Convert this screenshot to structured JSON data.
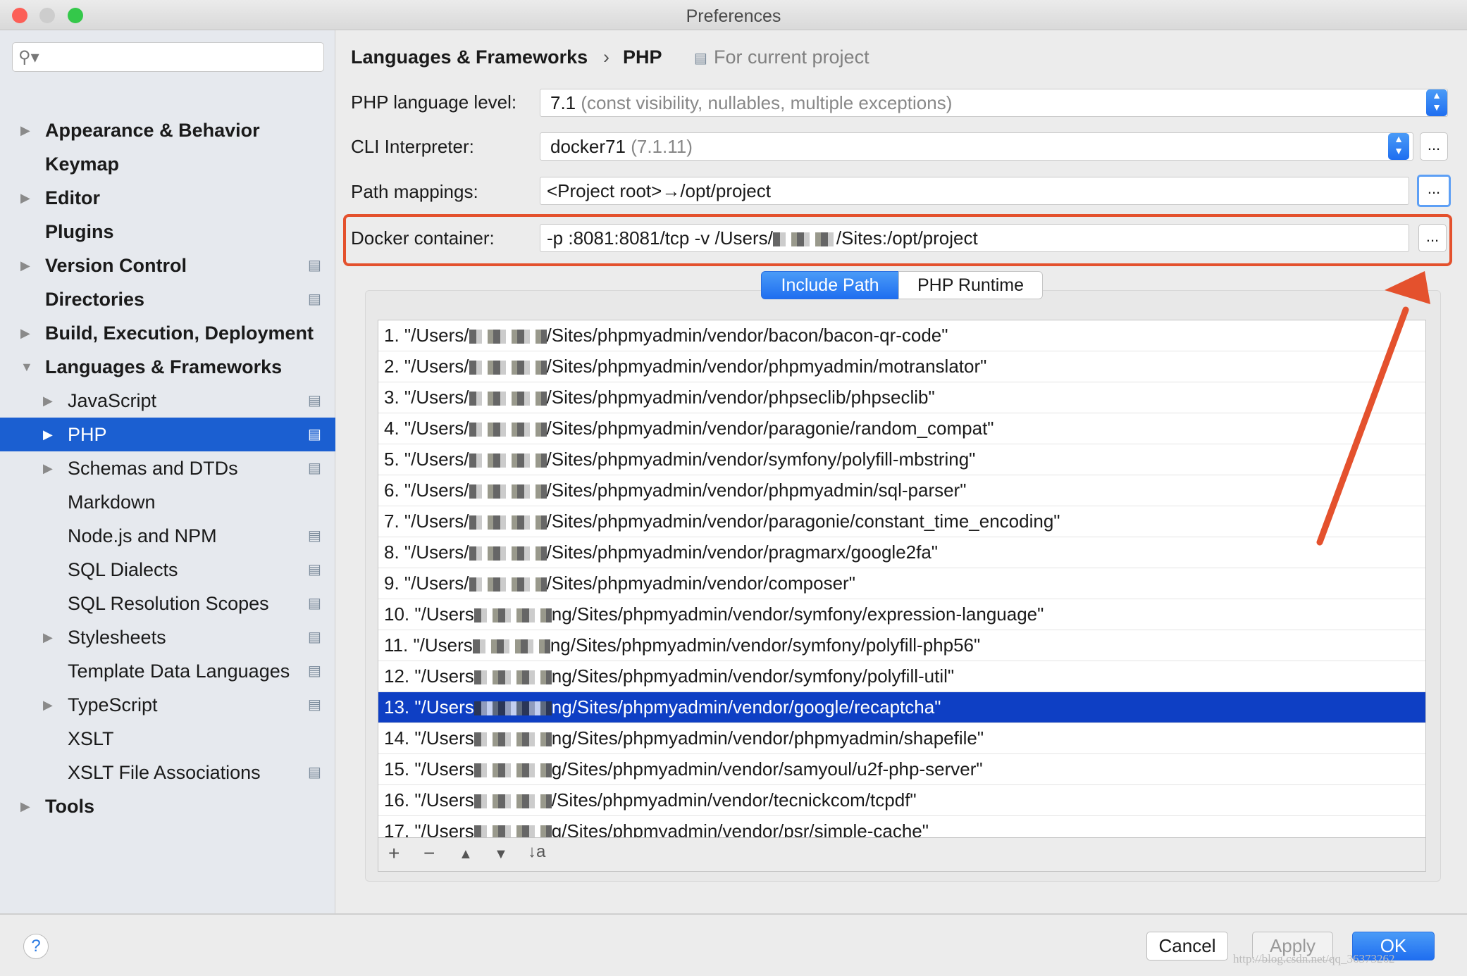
{
  "window": {
    "title": "Preferences"
  },
  "sidebar": {
    "search_placeholder": "",
    "items": [
      {
        "label": "Appearance & Behavior",
        "level": 0,
        "expandable": true,
        "project": false
      },
      {
        "label": "Keymap",
        "level": 0,
        "expandable": false,
        "project": false
      },
      {
        "label": "Editor",
        "level": 0,
        "expandable": true,
        "project": false
      },
      {
        "label": "Plugins",
        "level": 0,
        "expandable": false,
        "project": false
      },
      {
        "label": "Version Control",
        "level": 0,
        "expandable": true,
        "project": true
      },
      {
        "label": "Directories",
        "level": 0,
        "expandable": false,
        "project": true
      },
      {
        "label": "Build, Execution, Deployment",
        "level": 0,
        "expandable": true,
        "project": false
      },
      {
        "label": "Languages & Frameworks",
        "level": 0,
        "expandable": true,
        "expanded": true,
        "project": false
      },
      {
        "label": "JavaScript",
        "level": 1,
        "expandable": true,
        "project": true
      },
      {
        "label": "PHP",
        "level": 1,
        "expandable": true,
        "project": true,
        "selected": true
      },
      {
        "label": "Schemas and DTDs",
        "level": 1,
        "expandable": true,
        "project": true
      },
      {
        "label": "Markdown",
        "level": 1,
        "expandable": false,
        "project": false
      },
      {
        "label": "Node.js and NPM",
        "level": 1,
        "expandable": false,
        "project": true
      },
      {
        "label": "SQL Dialects",
        "level": 1,
        "expandable": false,
        "project": true
      },
      {
        "label": "SQL Resolution Scopes",
        "level": 1,
        "expandable": false,
        "project": true
      },
      {
        "label": "Stylesheets",
        "level": 1,
        "expandable": true,
        "project": true
      },
      {
        "label": "Template Data Languages",
        "level": 1,
        "expandable": false,
        "project": true
      },
      {
        "label": "TypeScript",
        "level": 1,
        "expandable": true,
        "project": true
      },
      {
        "label": "XSLT",
        "level": 1,
        "expandable": false,
        "project": false
      },
      {
        "label": "XSLT File Associations",
        "level": 1,
        "expandable": false,
        "project": true
      },
      {
        "label": "Tools",
        "level": 0,
        "expandable": true,
        "project": false
      }
    ]
  },
  "breadcrumb": {
    "parent": "Languages & Frameworks",
    "separator": "›",
    "current": "PHP",
    "scope": "For current project"
  },
  "form": {
    "language_level": {
      "label": "PHP language level:",
      "value": "7.1",
      "hint": "(const visibility, nullables, multiple exceptions)"
    },
    "cli": {
      "label": "CLI Interpreter:",
      "value": "docker71",
      "hint": "(7.1.11)",
      "more": "..."
    },
    "path_mappings": {
      "label": "Path mappings:",
      "value": "<Project root>→/opt/project",
      "more": "..."
    },
    "docker": {
      "label": "Docker container:",
      "value_prefix": "-p :8081:8081/tcp -v /Users/",
      "value_suffix": "/Sites:/opt/project",
      "more": "..."
    }
  },
  "tabs": [
    {
      "label": "Include Path",
      "active": true
    },
    {
      "label": "PHP Runtime",
      "active": false
    }
  ],
  "include_paths": [
    {
      "n": "1.",
      "pre": "\"/Users/",
      "path": "/Sites/phpmyadmin/vendor/bacon/bacon-qr-code\""
    },
    {
      "n": "2.",
      "pre": "\"/Users/",
      "path": "/Sites/phpmyadmin/vendor/phpmyadmin/motranslator\""
    },
    {
      "n": "3.",
      "pre": "\"/Users/",
      "path": "/Sites/phpmyadmin/vendor/phpseclib/phpseclib\""
    },
    {
      "n": "4.",
      "pre": "\"/Users/",
      "path": "/Sites/phpmyadmin/vendor/paragonie/random_compat\""
    },
    {
      "n": "5.",
      "pre": "\"/Users/",
      "path": "/Sites/phpmyadmin/vendor/symfony/polyfill-mbstring\""
    },
    {
      "n": "6.",
      "pre": "\"/Users/",
      "path": "/Sites/phpmyadmin/vendor/phpmyadmin/sql-parser\""
    },
    {
      "n": "7.",
      "pre": "\"/Users/",
      "path": "/Sites/phpmyadmin/vendor/paragonie/constant_time_encoding\""
    },
    {
      "n": "8.",
      "pre": "\"/Users/",
      "path": "/Sites/phpmyadmin/vendor/pragmarx/google2fa\""
    },
    {
      "n": "9.",
      "pre": "\"/Users/",
      "path": "/Sites/phpmyadmin/vendor/composer\""
    },
    {
      "n": "10.",
      "pre": "\"/Users",
      "path": "ng/Sites/phpmyadmin/vendor/symfony/expression-language\""
    },
    {
      "n": "11.",
      "pre": "\"/Users",
      "path": "ng/Sites/phpmyadmin/vendor/symfony/polyfill-php56\""
    },
    {
      "n": "12.",
      "pre": "\"/Users",
      "path": "ng/Sites/phpmyadmin/vendor/symfony/polyfill-util\""
    },
    {
      "n": "13.",
      "pre": "\"/Users",
      "path": "ng/Sites/phpmyadmin/vendor/google/recaptcha\"",
      "selected": true
    },
    {
      "n": "14.",
      "pre": "\"/Users",
      "path": "ng/Sites/phpmyadmin/vendor/phpmyadmin/shapefile\""
    },
    {
      "n": "15.",
      "pre": "\"/Users",
      "path": "g/Sites/phpmyadmin/vendor/samyoul/u2f-php-server\""
    },
    {
      "n": "16.",
      "pre": "\"/Users",
      "path": "/Sites/phpmyadmin/vendor/tecnickcom/tcpdf\""
    },
    {
      "n": "17.",
      "pre": "\"/Users",
      "path": "g/Sites/phpmyadmin/vendor/psr/simple-cache\""
    }
  ],
  "toolbar": {
    "add": "+",
    "remove": "−",
    "up": "▲",
    "down": "▼",
    "sort": "↓a"
  },
  "buttons": {
    "help": "?",
    "cancel": "Cancel",
    "apply": "Apply",
    "ok": "OK"
  },
  "watermark": "http://blog.csdn.net/qq_36373262",
  "colors": {
    "accent": "#1b5fd1",
    "selection": "#0e3fc4",
    "annotation": "#e4512d"
  }
}
